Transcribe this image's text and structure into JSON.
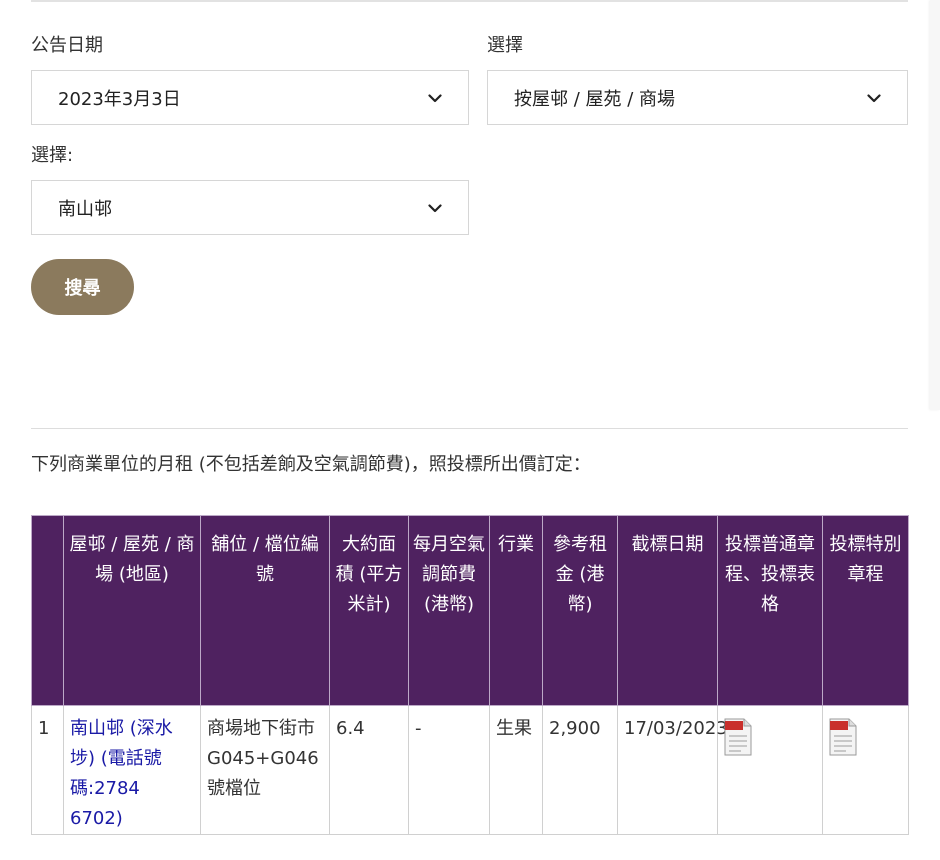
{
  "form": {
    "announcement_date_label": "公告日期",
    "announcement_date_value": "2023年3月3日",
    "select_label_1": "選擇",
    "select_value_1": "按屋邨 / 屋苑 / 商場",
    "select_label_2": "選擇:",
    "select_value_2": "南山邨",
    "search_button": "搜尋"
  },
  "note": "下列商業單位的月租 (不包括差餉及空氣調節費)，照投標所出價訂定：",
  "table": {
    "headers": [
      "",
      "屋邨 / 屋苑 / 商場 (地區)",
      "舖位 / 檔位編號",
      "大約面積 (平方米計)",
      "每月空氣調節費 (港幣)",
      "行業",
      "參考租金 (港幣)",
      "截標日期",
      "投標普通章程、投標表格",
      "投標特別章程"
    ],
    "rows": [
      {
        "index": "1",
        "estate": "南山邨 (深水埗) (電話號碼:2784 6702)",
        "shop_no": "商場地下街市G045+G046號檔位",
        "area": "6.4",
        "ac_fee": "-",
        "trade": "生果",
        "ref_rent": "2,900",
        "closing_date": "17/03/2023",
        "general_doc_icon": "pdf-icon",
        "special_doc_icon": "pdf-icon"
      }
    ]
  },
  "colors": {
    "header_purple": "#4f2260",
    "button_brown": "#8b7a5d",
    "link_blue": "#1a1aa6"
  }
}
